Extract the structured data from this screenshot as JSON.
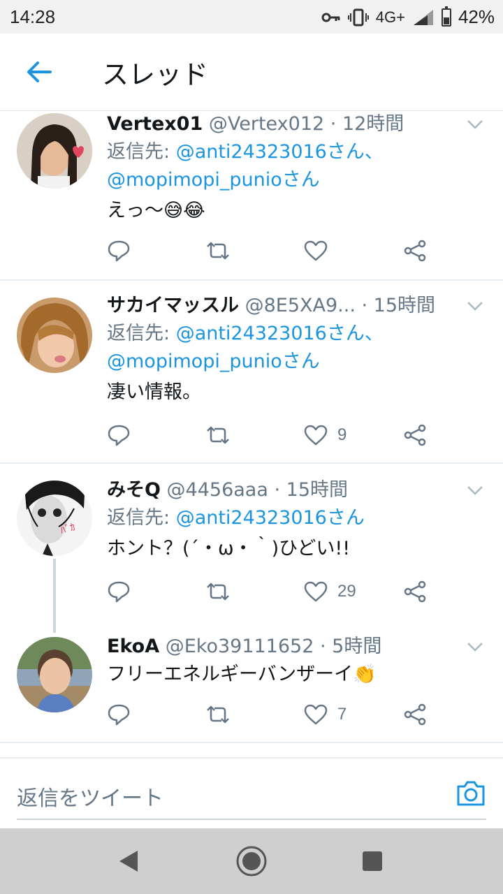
{
  "status_bar": {
    "time": "14:28",
    "network": "4G+",
    "battery": "42%",
    "battery_level": 0.42
  },
  "app_bar": {
    "title": "スレッド",
    "back_icon": "arrow-left-icon"
  },
  "colors": {
    "accent": "#1b95e0",
    "muted": "#657786",
    "text": "#14171a",
    "divider": "#e6ecf0"
  },
  "tweets": [
    {
      "name": "Vertex01",
      "handle": "@Vertex012",
      "time": "· 12時間",
      "reply_prefix": "返信先: ",
      "mentions_line1": "@anti24323016さん、",
      "mentions_line2": "@mopimopi_punioさん",
      "text": "えっ〜😅😂",
      "likes": ""
    },
    {
      "name": "サカイマッスル",
      "handle": "@8E5XA9...",
      "time": "· 15時間",
      "reply_prefix": "返信先: ",
      "mentions_line1": "@anti24323016さん、",
      "mentions_line2": "@mopimopi_punioさん",
      "text": "凄い情報。",
      "likes": "9"
    },
    {
      "name": "みそQ",
      "handle": "@4456aaa",
      "time": "· 15時間",
      "reply_prefix": "返信先: ",
      "mentions_line1": "@anti24323016さん",
      "text": "ホント？(´・ω・｀)ひどい!!",
      "likes": "29"
    },
    {
      "name": "EkoA",
      "handle": "@Eko39111652",
      "time": "· 5時間",
      "text": "フリーエネルギーバンザーイ👏",
      "likes": "7"
    }
  ],
  "reply_bar": {
    "placeholder": "返信をツイート",
    "camera_icon": "camera-icon"
  },
  "nav_bar": {
    "back": "nav-back-icon",
    "home": "nav-home-icon",
    "recents": "nav-recents-icon"
  }
}
